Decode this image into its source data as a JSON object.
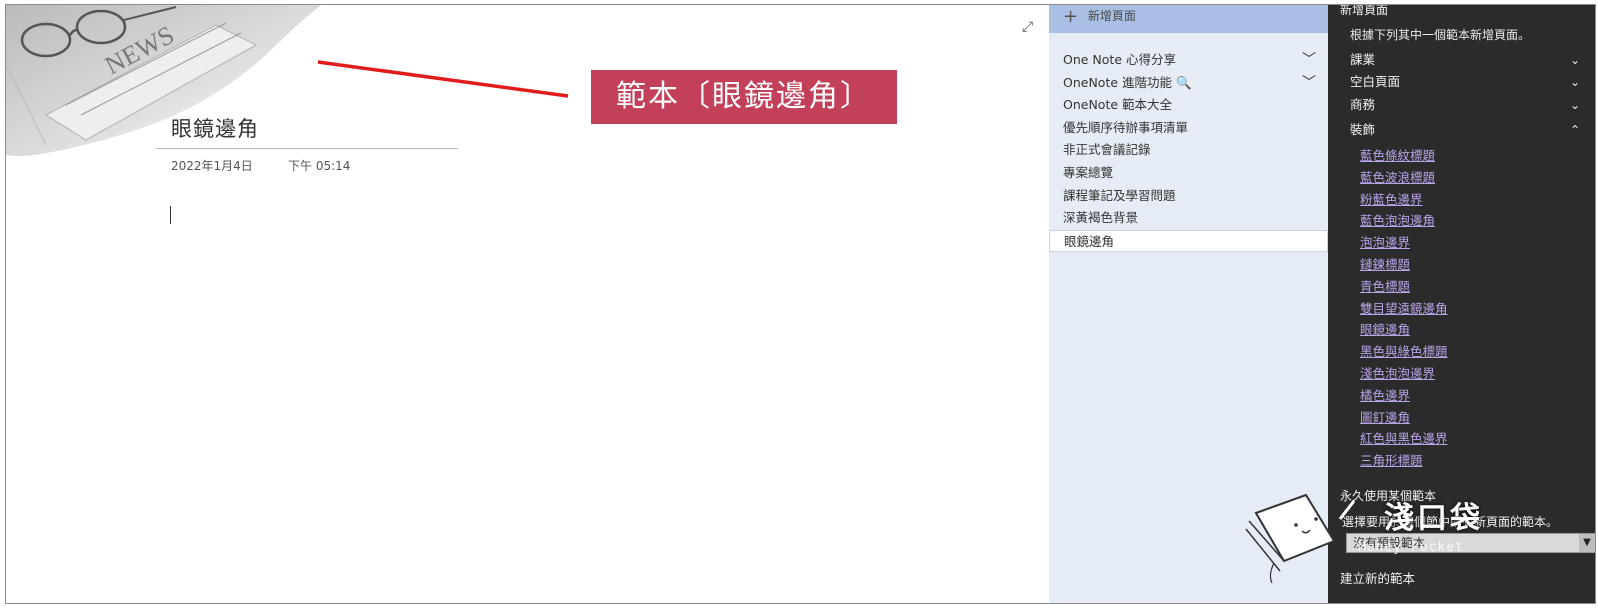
{
  "canvas": {
    "page_title": "眼鏡邊角",
    "date": "2022年1月4日",
    "time": "下午 05:14",
    "callout": "範本〔眼鏡邊角〕"
  },
  "page_list": {
    "add_page_label": "新增頁面",
    "items": [
      {
        "label": "One Note 心得分享",
        "has_chevron": true
      },
      {
        "label": "OneNote 進階功能 🔍",
        "has_chevron": true
      },
      {
        "label": "OneNote 範本大全",
        "has_chevron": false
      },
      {
        "label": "優先順序待辦事項清單",
        "has_chevron": false
      },
      {
        "label": "非正式會議記錄",
        "has_chevron": false
      },
      {
        "label": "專案總覽",
        "has_chevron": false
      },
      {
        "label": "課程筆記及學習問題",
        "has_chevron": false
      },
      {
        "label": "深黃褐色背景",
        "has_chevron": false
      },
      {
        "label": "眼鏡邊角",
        "has_chevron": false,
        "selected": true
      }
    ]
  },
  "templates": {
    "heading": "新增頁面",
    "description": "根據下列其中一個範本新增頁面。",
    "categories": [
      {
        "label": "課業",
        "expanded": false
      },
      {
        "label": "空白頁面",
        "expanded": false
      },
      {
        "label": "商務",
        "expanded": false
      },
      {
        "label": "裝飾",
        "expanded": true
      }
    ],
    "decorative_items": [
      "藍色條紋標題",
      "藍色波浪標題",
      "粉藍色邊界",
      "藍色泡泡邊角",
      "泡泡邊界",
      "鏈鍊標題",
      "青色標題",
      "雙目望遠鏡邊角",
      "眼鏡邊角",
      "黑色與綠色標題",
      "淺色泡泡邊界",
      "橘色邊界",
      "圖釘邊角",
      "紅色與黑色邊界",
      "三角形標題"
    ],
    "default_label": "永久使用某個範本",
    "default_desc": "選擇要用於這個節中所有新頁面的範本。",
    "select_value": "沒有預設範本",
    "create_new": "建立新的範本"
  },
  "watermark": {
    "brand": "淺口袋",
    "sub": "Money Pocket"
  },
  "colors": {
    "callout_bg": "#c2405a",
    "callout_line": "#e21b1b",
    "page_list_bg": "#e6ecf5",
    "add_page_bg": "#a9bfe4",
    "template_pane_bg": "#2b2b2b",
    "template_link": "#b9a3e8"
  }
}
